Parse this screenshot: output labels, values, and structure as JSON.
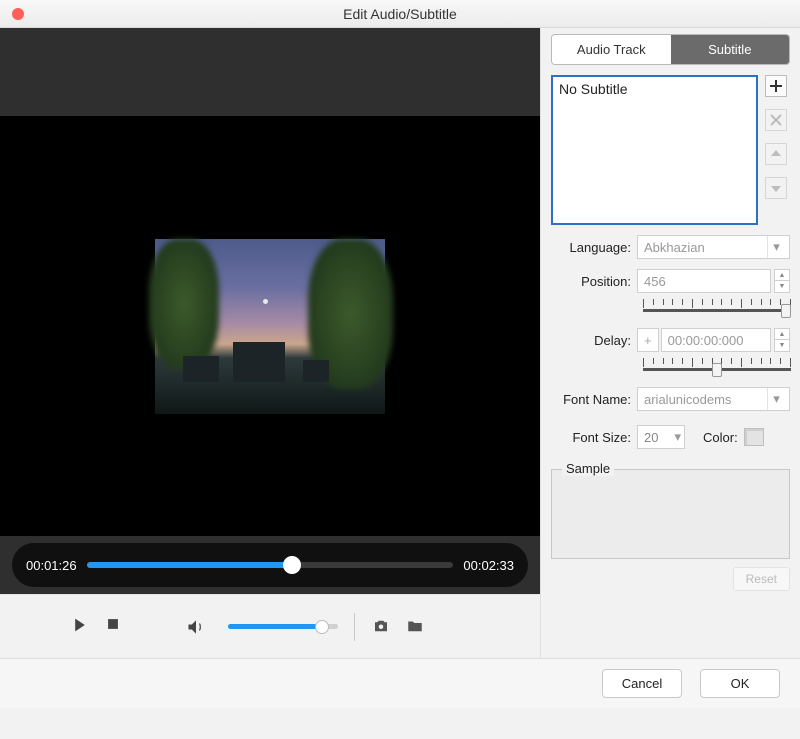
{
  "window": {
    "title": "Edit Audio/Subtitle"
  },
  "tabs": {
    "audio_track": "Audio Track",
    "subtitle": "Subtitle"
  },
  "subtitle_list": {
    "selected": "No Subtitle"
  },
  "language": {
    "label": "Language:",
    "value": "Abkhazian"
  },
  "position": {
    "label": "Position:",
    "value": "456"
  },
  "delay": {
    "label": "Delay:",
    "prefix": "+",
    "value": "00:00:00:000"
  },
  "font_name": {
    "label": "Font Name:",
    "value": "arialunicodems"
  },
  "font_size": {
    "label": "Font Size:",
    "value": "20"
  },
  "color": {
    "label": "Color:"
  },
  "sample": {
    "label": "Sample"
  },
  "buttons": {
    "reset": "Reset",
    "cancel": "Cancel",
    "ok": "OK"
  },
  "player": {
    "current_time": "00:01:26",
    "duration": "00:02:33"
  }
}
